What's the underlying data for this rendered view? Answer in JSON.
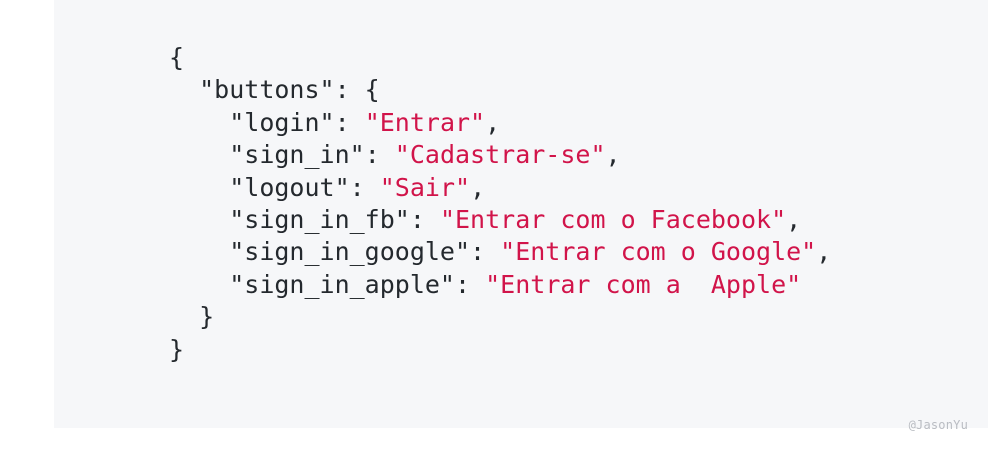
{
  "code": {
    "open_brace": "{",
    "buttons_key": "\"buttons\"",
    "buttons_open": ": {",
    "entries": [
      {
        "key": "\"login\"",
        "value": "\"Entrar\"",
        "trail": ","
      },
      {
        "key": "\"sign_in\"",
        "value": "\"Cadastrar-se\"",
        "trail": ","
      },
      {
        "key": "\"logout\"",
        "value": "\"Sair\"",
        "trail": ","
      },
      {
        "key": "\"sign_in_fb\"",
        "value": "\"Entrar com o Facebook\"",
        "trail": ","
      },
      {
        "key": "\"sign_in_google\"",
        "value": "\"Entrar com o Google\"",
        "trail": ","
      },
      {
        "key": "\"sign_in_apple\"",
        "value": "\"Entrar com a  Apple\"",
        "trail": ""
      }
    ],
    "inner_close": "}",
    "outer_close": "}"
  },
  "watermark": "@JasonYu",
  "colors": {
    "panel_background": "#f6f7f9",
    "text": "#24292e",
    "string": "#d1144a",
    "watermark": "#b9bcc2"
  }
}
